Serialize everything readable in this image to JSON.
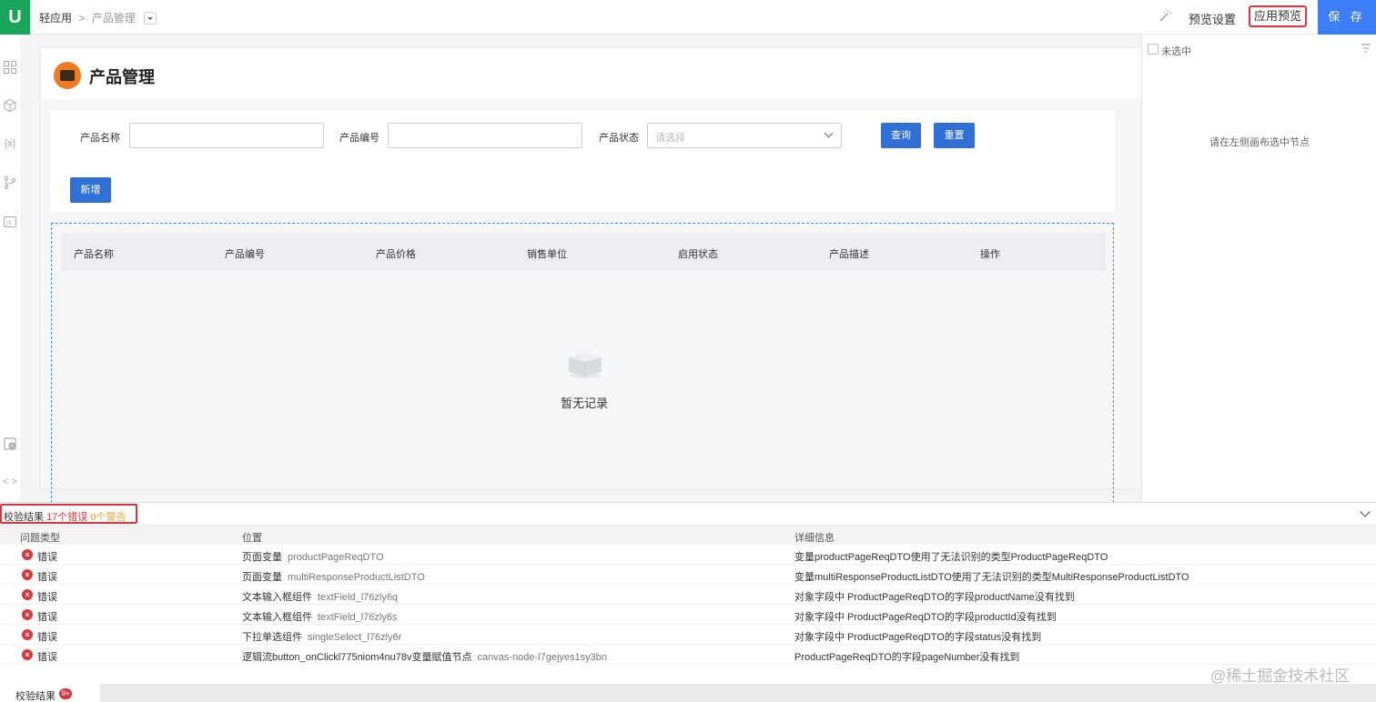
{
  "topbar": {
    "logo": "U",
    "breadcrumb_root": "轻应用",
    "breadcrumb_sep": ">",
    "breadcrumb_current": "产品管理",
    "preview_settings": "预览设置",
    "app_preview": "应用预览",
    "save": "保 存"
  },
  "page": {
    "title": "产品管理",
    "filters": {
      "name_label": "产品名称",
      "code_label": "产品编号",
      "status_label": "产品状态",
      "status_placeholder": "请选择",
      "query_button": "查询",
      "reset_button": "重置",
      "add_button": "新增"
    },
    "table": {
      "columns": [
        "产品名称",
        "产品编号",
        "产品价格",
        "销售单位",
        "启用状态",
        "产品描述",
        "操作"
      ],
      "empty_text": "暂无记录"
    }
  },
  "right_panel": {
    "unselected_label": "未选中",
    "hint": "请在左侧画布选中节点"
  },
  "validation": {
    "title": "校验结果",
    "error_count": "17个错误",
    "warning_count": "0个警告",
    "headers": [
      "问题类型",
      "位置",
      "详细信息"
    ],
    "rows": [
      {
        "type": "错误",
        "position": "页面变量",
        "position_sub": "productPageReqDTO",
        "detail": "变量productPageReqDTO使用了无法识别的类型ProductPageReqDTO"
      },
      {
        "type": "错误",
        "position": "页面变量",
        "position_sub": "multiResponseProductListDTO",
        "detail": "变量multiResponseProductListDTO使用了无法识别的类型MultiResponseProductListDTO"
      },
      {
        "type": "错误",
        "position": "文本输入框组件",
        "position_sub": "textField_l76zly6q",
        "detail": "对象字段中 ProductPageReqDTO的字段productName没有找到"
      },
      {
        "type": "错误",
        "position": "文本输入框组件",
        "position_sub": "textField_l76zly6s",
        "detail": "对象字段中 ProductPageReqDTO的字段productId没有找到"
      },
      {
        "type": "错误",
        "position": "下拉单选组件",
        "position_sub": "singleSelect_l76zly6r",
        "detail": "对象字段中 ProductPageReqDTO的字段status没有找到"
      },
      {
        "type": "错误",
        "position": "逻辑流button_onClickl775niom4nu78v变量赋值节点",
        "position_sub": "canvas-node-l7gejyes1sy3bn",
        "detail": "ProductPageReqDTO的字段pageNumber没有找到"
      }
    ],
    "watermark": "@稀土掘金技术社区"
  },
  "bottom_tab": {
    "label": "校验结果",
    "badge": "9+"
  },
  "colors": {
    "accent": "#3d7ef6",
    "error": "#d9363e",
    "warning": "#e8a33b",
    "logo": "#1aa55a",
    "page_icon": "#f07a1f"
  },
  "icons": {
    "rail": [
      "grid-icon",
      "cube-icon",
      "variable-icon",
      "branch-icon",
      "js-icon",
      "component-icon",
      "code-icon"
    ]
  }
}
